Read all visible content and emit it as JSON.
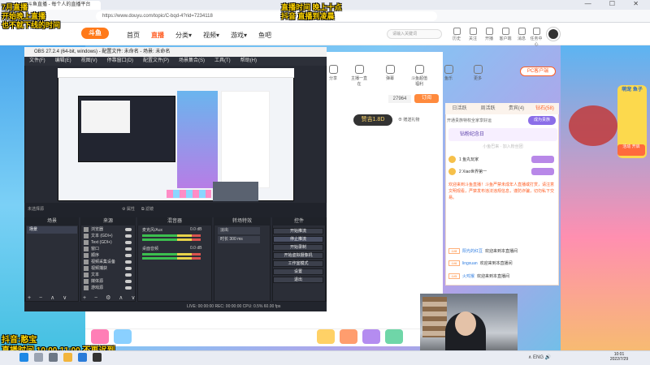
{
  "browser": {
    "tab_title": "斗鱼直播 - 每个人的直播平台",
    "url": "https://www.douyu.com/topic/C-bqd-4?rid=7234118",
    "window_controls": "— ☐ ✕"
  },
  "site": {
    "logo": "斗鱼",
    "nav": [
      "首页",
      "直播",
      "分类▾",
      "视频▾",
      "游戏▾",
      "鱼吧"
    ],
    "search_placeholder": "请输入关键词",
    "header_icons": [
      "历史",
      "关注",
      "开播",
      "客户端",
      "消息",
      "任务中心"
    ]
  },
  "room": {
    "icons": [
      "分享",
      "主播一直在",
      "弹幕",
      "斗鱼超值福利",
      "鱼乐",
      "更多"
    ],
    "pc_button": "PC客户端",
    "level": "27964",
    "subscribe": "订阅",
    "gift_badge": "赞吉1.8D",
    "gift_note": "⊕ 赠送礼物"
  },
  "chat": {
    "tabs": [
      "日活跃",
      "周活跃",
      "贵宾(4)",
      "钻石(58)"
    ],
    "fan_row": "开通贵族特权全家享好运",
    "fan_button": "成为贵族",
    "fan_bar": "钻粉纪念日",
    "fan_hint": "小鱼巴来 · 加入粉丝团",
    "rank": [
      "1  鱼丸玩家",
      "2  Xiao世界第一"
    ],
    "notice": "欢迎来到斗鱼直播！斗鱼严禁未成年人直播或打赏，请注意文明观看，严禁发布违法违规信息，谨防诈骗，切勿私下交易。",
    "messages": [
      {
        "lv": "LV8",
        "name": "阳光的红豆",
        "text": "欢迎来到本直播间"
      },
      {
        "lv": "LV6",
        "name": "lingxuan",
        "text": "欢迎来到本直播间"
      },
      {
        "lv": "LV5",
        "name": "火鸡猴",
        "text": "欢迎来到本直播间"
      }
    ]
  },
  "obs": {
    "title": "OBS 27.2.4 (64-bit, windows) - 配置文件: 未命名 - 场景: 未命名",
    "menu": [
      "文件(F)",
      "编辑(E)",
      "视图(V)",
      "停靠窗口(D)",
      "配置文件(P)",
      "场景集合(S)",
      "工具(T)",
      "帮助(H)"
    ],
    "strip": [
      "未选择源",
      "⚙ 属性",
      "⧉ 滤镜"
    ],
    "docks": {
      "scenes": "场景",
      "sources": "来源",
      "mixer": "混音器",
      "transitions": "转场特效",
      "controls": "控件"
    },
    "scene_selected": "场景",
    "sources": [
      "浏览器",
      "文本 (GDI+)",
      "Text (GDI+)",
      "窗口",
      "顺序",
      "视频采集设备",
      "视频捕获",
      "文本",
      "媒体源",
      "游戏源",
      "Idle 源",
      "显示器采集"
    ],
    "mixer": [
      {
        "label": "麦克风/Aux",
        "vol": "0.0 dB"
      },
      {
        "label": "桌面音频",
        "vol": "0.0 dB"
      }
    ],
    "transition_type": "淡出",
    "transition_duration": "时长  300 ms",
    "controls": [
      "开始推流",
      "停止推流",
      "开始录制",
      "开始虚拟摄像机",
      "工作室模式",
      "设置",
      "退出"
    ],
    "status": "LIVE: 00:00:00    REC: 00:00:00    CPU: 0.5%  60.00 fps"
  },
  "overlays": {
    "top_left_1": "7月直播",
    "top_left_2": "开始晚上直播",
    "top_left_3": "也不就下线的时间",
    "top_center_1": "直播时间 晚上十点",
    "top_center_2": "抖音 直播到凌晨",
    "bottom_left_1": "抖音:憨宝",
    "bottom_left_2": "直播时间 10:00-11:00 不再迟到"
  },
  "taskbar": {
    "clock_time": "10:01",
    "clock_date": "2022/7/29",
    "tray": "∧  ENG  🔊"
  },
  "play_badge": "萌宠 鱼子",
  "play_ad": "活动 开启"
}
